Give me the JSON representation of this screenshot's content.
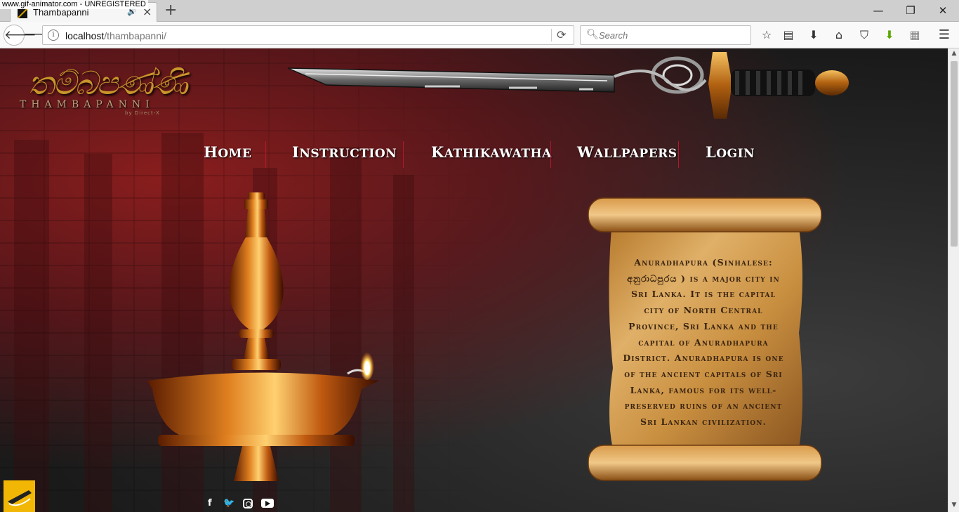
{
  "watermark": "www.gif-animator.com - UNREGISTERED",
  "browser": {
    "tab_title": "Thambapanni",
    "tab_audio_icon": "speaker-icon",
    "url_host": "localhost",
    "url_path": "/thambapanni/",
    "search_placeholder": "Search",
    "window_controls": {
      "minimize": "—",
      "restore": "❐",
      "close": "✕"
    },
    "toolbar_icons": [
      "star-icon",
      "reading-list-icon",
      "download-icon",
      "home-icon",
      "pocket-icon",
      "addon-download-icon",
      "addon-info-icon",
      "hamburger-menu-icon"
    ]
  },
  "site": {
    "logo_script": "තම්බපණ්ණි",
    "logo_text": "THAMBAPANNI",
    "logo_sub": "by Direct-X",
    "menu": [
      {
        "cap": "H",
        "rest": "OME"
      },
      {
        "cap": "I",
        "rest": "NSTRUCTION"
      },
      {
        "cap": "K",
        "rest": "ATHIKAWATHA"
      },
      {
        "cap": "W",
        "rest": "ALLPAPERS"
      },
      {
        "cap": "L",
        "rest": "OGIN"
      }
    ],
    "scroll_text": "Anuradhapura (Sinhalese: අනුරාධපුරය ) is a major city in Sri Lanka. It is the capital city of North Central Province, Sri Lanka and the capital of Anuradhapura District. Anuradhapura is one of the ancient capitals of Sri Lanka, famous for its well-preserved ruins of an ancient Sri Lankan civilization.",
    "social": {
      "facebook": "f",
      "twitter": "🐦",
      "instagram": "instagram-icon",
      "youtube": "youtube-icon"
    }
  },
  "colors": {
    "accent_gold": "#c9952b",
    "menu_divider": "#b2182b",
    "badge": "#f2b705"
  }
}
